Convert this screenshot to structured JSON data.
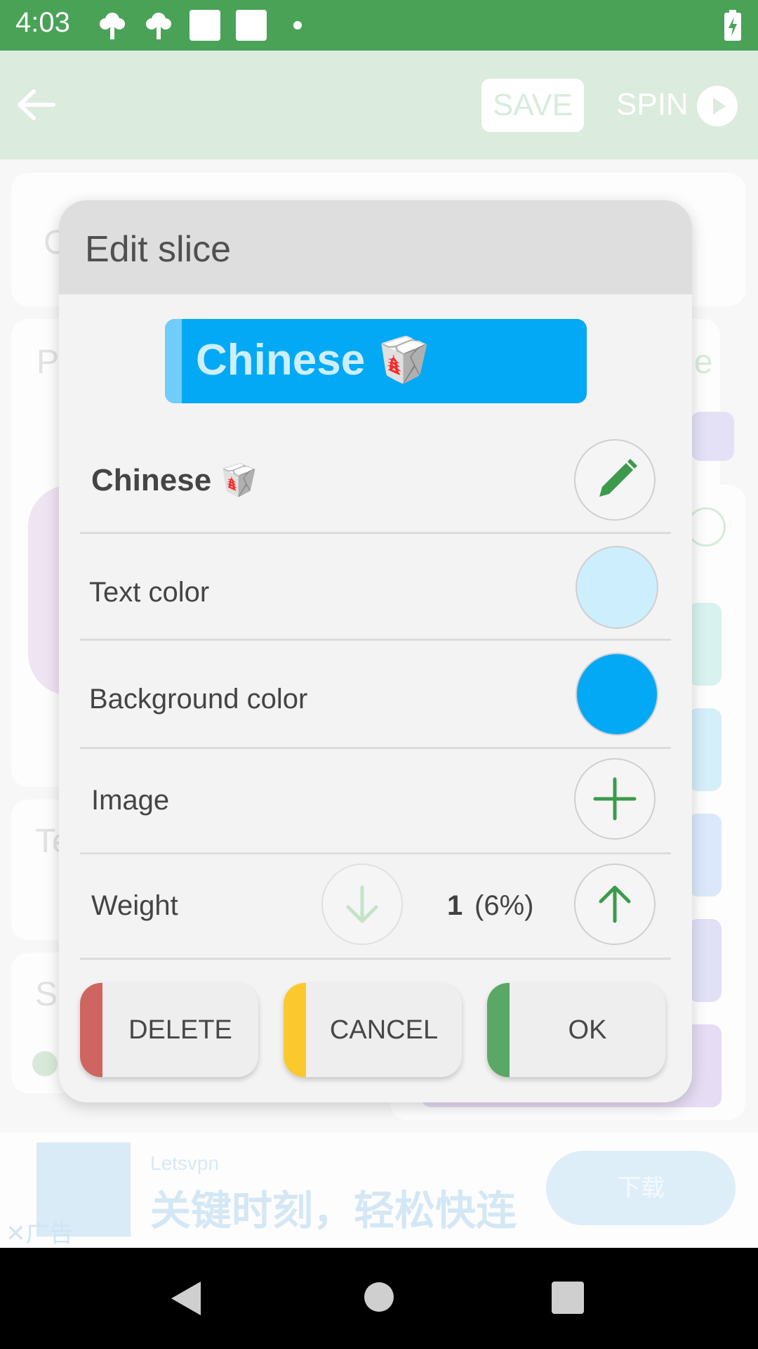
{
  "status_bar": {
    "time": "4:03",
    "icons": [
      "notification-icon",
      "notification-icon",
      "square-icon",
      "square-icon",
      "dot-icon",
      "battery-charging-icon"
    ]
  },
  "app_bar": {
    "save_label": "SAVE",
    "spin_label": "SPIN",
    "color_bar": "#dbebdd"
  },
  "background": {
    "card_letters": [
      "C",
      "P",
      "Te",
      "S"
    ],
    "tab_text": "ge"
  },
  "dialog": {
    "title": "Edit slice",
    "preview": {
      "text": "Chinese 🥡",
      "text_color": "#cdeefd",
      "background_color": "#03a9f4"
    },
    "slice_name": "Chinese 🥡",
    "rows": {
      "text_color_label": "Text color",
      "background_color_label": "Background color",
      "image_label": "Image",
      "weight_label": "Weight",
      "weight_value": "1",
      "weight_percent": "(6%)"
    },
    "buttons": {
      "delete": "DELETE",
      "cancel": "CANCEL",
      "ok": "OK"
    },
    "button_colors": {
      "delete": "#cf6560",
      "cancel": "#fbc92d",
      "ok": "#5aa865"
    }
  },
  "ad": {
    "brand": "Letsvpn",
    "slogan": "关键时刻，轻松快连",
    "download_label": "下载",
    "ad_tag": "广告"
  }
}
